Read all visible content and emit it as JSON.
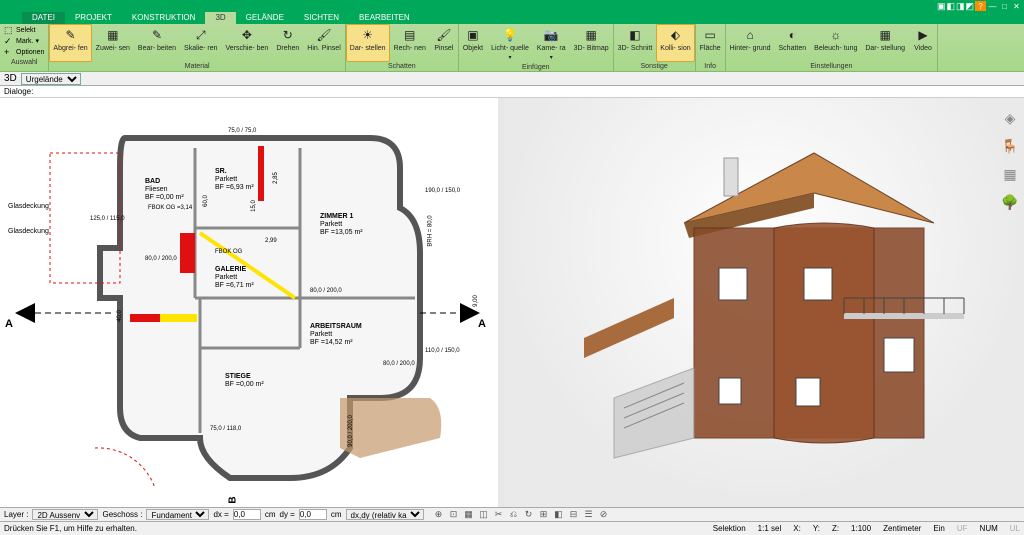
{
  "titlebar": {
    "help": "?",
    "min": "—",
    "close": "✕"
  },
  "menus": {
    "file": "DATEI",
    "tabs": [
      "PROJEKT",
      "KONSTRUKTION",
      "3D",
      "GELÄNDE",
      "SICHTEN",
      "BEARBEITEN"
    ],
    "active": 2
  },
  "ribbon": {
    "groups": {
      "auswahl": {
        "label": "Auswahl",
        "select": "Selekt",
        "mark": "Mark.",
        "optionen": "Optionen"
      },
      "material": {
        "label": "Material",
        "items": [
          "Abgrei-\nfen",
          "Zuwei-\nsen",
          "Bear-\nbeiten",
          "Skalie-\nren",
          "Verschie-\nben",
          "Drehen",
          "Hin.\nPinsel"
        ]
      },
      "schatten": {
        "label": "Schatten",
        "items": [
          "Dar-\nstellen",
          "Rech-\nnen",
          "Pinsel"
        ]
      },
      "einfugen": {
        "label": "Einfügen",
        "items": [
          "Objekt",
          "Licht-\nquelle",
          "Kame-\nra",
          "3D-\nBitmap"
        ]
      },
      "sonstige": {
        "label": "Sonstige",
        "items": [
          "3D-\nSchnitt",
          "Kolli-\nsion"
        ]
      },
      "info": {
        "label": "Info",
        "items": [
          "Fläche"
        ]
      },
      "einstellungen": {
        "label": "Einstellungen",
        "items": [
          "Hinter-\ngrund",
          "Schatten",
          "Beleuch-\ntung",
          "Dar-\nstellung",
          "Video"
        ]
      }
    }
  },
  "secbar": {
    "mode": "3D",
    "scene": "Urgelände"
  },
  "dialogbar": {
    "label": "Dialoge:"
  },
  "plan": {
    "glasdeckung1": "Glasdeckung",
    "glasdeckung2": "Glasdeckung",
    "sectionA": "A",
    "sectionB": "B",
    "rooms": {
      "bad": {
        "name": "BAD",
        "surface": "Fliesen",
        "area": "BF =0,00 m²",
        "fbok": "FBOK OG\n=3,14"
      },
      "sr": {
        "name": "SR.",
        "surface": "Parkett",
        "area": "BF =6,93 m²"
      },
      "zimmer1": {
        "name": "ZIMMER 1",
        "surface": "Parkett",
        "area": "BF =13,05 m²"
      },
      "galerie": {
        "name": "GALERIE",
        "surface": "Parkett",
        "area": "BF =6,71 m²",
        "fbok": "FBOK OG"
      },
      "arbeitsraum": {
        "name": "ARBEITSRAUM",
        "surface": "Parkett",
        "area": "BF =14,52 m²"
      },
      "stiege": {
        "name": "STIEGE",
        "area": "BF =0,00 m²"
      }
    },
    "dims": {
      "d1": "125,0 / 115,0",
      "d2": "80,0 / 200,0",
      "d3": "190,0 / 150,0",
      "d4": "110,0 / 150,0",
      "d5": "80,0 / 200,0",
      "d6": "80,0 / 200,0",
      "d7": "BRH = 80,0",
      "d8": "75,0 / 75,0",
      "d9": "2,99",
      "d10": "2,85",
      "d11": "60,0",
      "d12": "15,0",
      "d13": "9,00",
      "d14": "75,0 / 118,0",
      "d15": "90,0 / 200,0",
      "d16": "40,0"
    }
  },
  "layerbar": {
    "layer_lbl": "Layer :",
    "layer_val": "2D Aussenv",
    "geschoss_lbl": "Geschoss :",
    "geschoss_val": "Fundament",
    "dx_lbl": "dx =",
    "dx_val": "0,0",
    "dy_lbl": "dy =",
    "dy_val": "0,0",
    "cm1": "cm",
    "cm2": "cm",
    "mode": "dx,dy (relativ ka"
  },
  "status": {
    "hint": "Drücken Sie F1, um Hilfe zu erhalten.",
    "selektion": "Selektion",
    "scale1": "1:1 sel",
    "x": "X:",
    "y": "Y:",
    "z": "Z:",
    "scale2": "1:100",
    "unit": "Zentimeter",
    "ein": "Ein",
    "uf": "UF",
    "num": "NUM",
    "ul": "UL"
  }
}
